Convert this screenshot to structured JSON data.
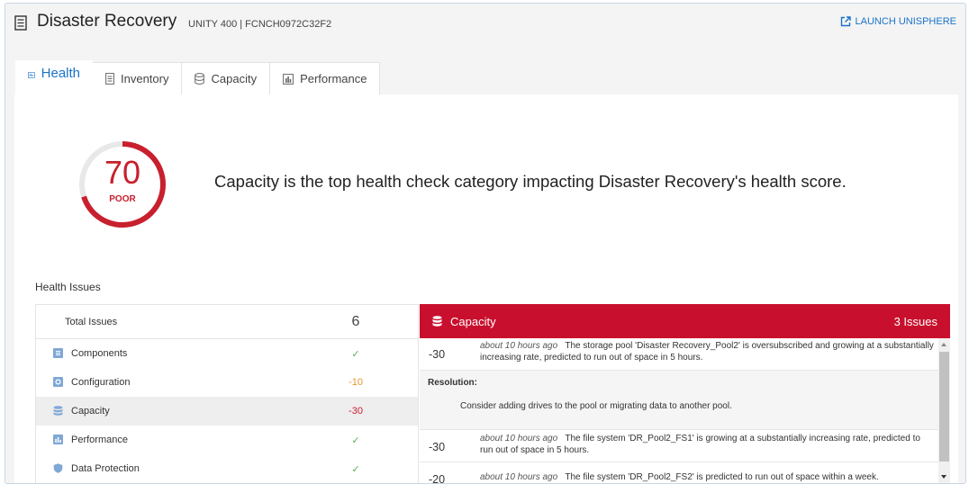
{
  "header": {
    "title": "Disaster Recovery",
    "subtitle": "UNITY 400 | FCNCH0972C32F2",
    "launch_label": "LAUNCH UNISPHERE"
  },
  "tabs": [
    {
      "label": "Health",
      "icon": "health-icon",
      "active": true
    },
    {
      "label": "Inventory",
      "icon": "inventory-icon"
    },
    {
      "label": "Capacity",
      "icon": "database-icon"
    },
    {
      "label": "Performance",
      "icon": "bar-chart-icon"
    }
  ],
  "score": {
    "value": "70",
    "rating": "POOR",
    "fraction": 0.7,
    "message": "Capacity is the top health check category impacting Disaster Recovery's health score."
  },
  "health_issues": {
    "title": "Health Issues",
    "total_label": "Total Issues",
    "total_value": "6",
    "categories": [
      {
        "label": "Components",
        "value": "✓",
        "status": "ok",
        "icon": "components-icon"
      },
      {
        "label": "Configuration",
        "value": "-10",
        "status": "warn",
        "icon": "configuration-icon"
      },
      {
        "label": "Capacity",
        "value": "-30",
        "status": "bad",
        "icon": "database-icon"
      },
      {
        "label": "Performance",
        "value": "✓",
        "status": "ok",
        "icon": "performance-icon"
      },
      {
        "label": "Data Protection",
        "value": "✓",
        "status": "ok",
        "icon": "shield-icon"
      }
    ]
  },
  "detail": {
    "category": "Capacity",
    "count_label": "3 Issues",
    "resolution_label": "Resolution:",
    "resolution_text": "Consider adding drives to the pool or migrating data to another pool.",
    "issues": [
      {
        "score": "-30",
        "time": "about 10 hours ago",
        "text": "The storage pool 'Disaster Recovery_Pool2' is oversubscribed and growing at a substantially increasing rate, predicted to run out of space in 5 hours."
      },
      {
        "score": "-30",
        "time": "about 10 hours ago",
        "text": "The file system 'DR_Pool2_FS1' is growing at a substantially increasing rate, predicted to run out of space in 5 hours."
      },
      {
        "score": "-20",
        "time": "about 10 hours ago",
        "text": "The file system 'DR_Pool2_FS2' is predicted to run out of space within a week."
      }
    ]
  },
  "colors": {
    "accent": "#1a73c9",
    "danger": "#c8102e",
    "warning": "#e9962b",
    "ok": "#5aab58"
  }
}
